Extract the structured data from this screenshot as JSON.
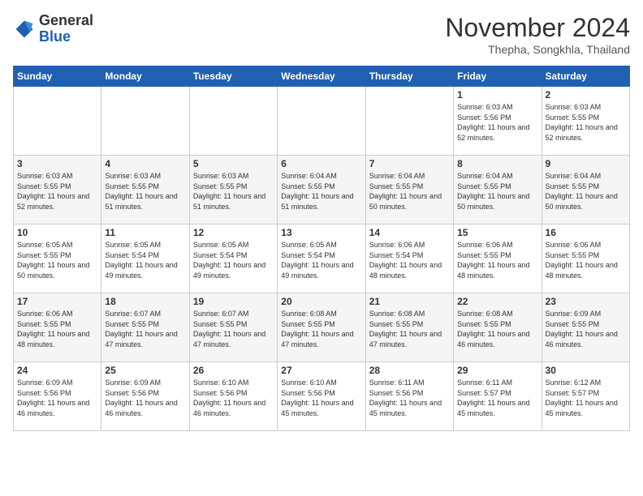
{
  "header": {
    "logo_general": "General",
    "logo_blue": "Blue",
    "month_title": "November 2024",
    "subtitle": "Thepha, Songkhla, Thailand"
  },
  "weekdays": [
    "Sunday",
    "Monday",
    "Tuesday",
    "Wednesday",
    "Thursday",
    "Friday",
    "Saturday"
  ],
  "weeks": [
    [
      null,
      null,
      null,
      null,
      null,
      {
        "day": 1,
        "sunrise": "6:03 AM",
        "sunset": "5:56 PM",
        "daylight": "11 hours and 52 minutes."
      },
      {
        "day": 2,
        "sunrise": "6:03 AM",
        "sunset": "5:55 PM",
        "daylight": "11 hours and 52 minutes."
      }
    ],
    [
      {
        "day": 3,
        "sunrise": "6:03 AM",
        "sunset": "5:55 PM",
        "daylight": "11 hours and 52 minutes."
      },
      {
        "day": 4,
        "sunrise": "6:03 AM",
        "sunset": "5:55 PM",
        "daylight": "11 hours and 51 minutes."
      },
      {
        "day": 5,
        "sunrise": "6:03 AM",
        "sunset": "5:55 PM",
        "daylight": "11 hours and 51 minutes."
      },
      {
        "day": 6,
        "sunrise": "6:04 AM",
        "sunset": "5:55 PM",
        "daylight": "11 hours and 51 minutes."
      },
      {
        "day": 7,
        "sunrise": "6:04 AM",
        "sunset": "5:55 PM",
        "daylight": "11 hours and 50 minutes."
      },
      {
        "day": 8,
        "sunrise": "6:04 AM",
        "sunset": "5:55 PM",
        "daylight": "11 hours and 50 minutes."
      },
      {
        "day": 9,
        "sunrise": "6:04 AM",
        "sunset": "5:55 PM",
        "daylight": "11 hours and 50 minutes."
      }
    ],
    [
      {
        "day": 10,
        "sunrise": "6:05 AM",
        "sunset": "5:55 PM",
        "daylight": "11 hours and 50 minutes."
      },
      {
        "day": 11,
        "sunrise": "6:05 AM",
        "sunset": "5:54 PM",
        "daylight": "11 hours and 49 minutes."
      },
      {
        "day": 12,
        "sunrise": "6:05 AM",
        "sunset": "5:54 PM",
        "daylight": "11 hours and 49 minutes."
      },
      {
        "day": 13,
        "sunrise": "6:05 AM",
        "sunset": "5:54 PM",
        "daylight": "11 hours and 49 minutes."
      },
      {
        "day": 14,
        "sunrise": "6:06 AM",
        "sunset": "5:54 PM",
        "daylight": "11 hours and 48 minutes."
      },
      {
        "day": 15,
        "sunrise": "6:06 AM",
        "sunset": "5:55 PM",
        "daylight": "11 hours and 48 minutes."
      },
      {
        "day": 16,
        "sunrise": "6:06 AM",
        "sunset": "5:55 PM",
        "daylight": "11 hours and 48 minutes."
      }
    ],
    [
      {
        "day": 17,
        "sunrise": "6:06 AM",
        "sunset": "5:55 PM",
        "daylight": "11 hours and 48 minutes."
      },
      {
        "day": 18,
        "sunrise": "6:07 AM",
        "sunset": "5:55 PM",
        "daylight": "11 hours and 47 minutes."
      },
      {
        "day": 19,
        "sunrise": "6:07 AM",
        "sunset": "5:55 PM",
        "daylight": "11 hours and 47 minutes."
      },
      {
        "day": 20,
        "sunrise": "6:08 AM",
        "sunset": "5:55 PM",
        "daylight": "11 hours and 47 minutes."
      },
      {
        "day": 21,
        "sunrise": "6:08 AM",
        "sunset": "5:55 PM",
        "daylight": "11 hours and 47 minutes."
      },
      {
        "day": 22,
        "sunrise": "6:08 AM",
        "sunset": "5:55 PM",
        "daylight": "11 hours and 46 minutes."
      },
      {
        "day": 23,
        "sunrise": "6:09 AM",
        "sunset": "5:55 PM",
        "daylight": "11 hours and 46 minutes."
      }
    ],
    [
      {
        "day": 24,
        "sunrise": "6:09 AM",
        "sunset": "5:56 PM",
        "daylight": "11 hours and 46 minutes."
      },
      {
        "day": 25,
        "sunrise": "6:09 AM",
        "sunset": "5:56 PM",
        "daylight": "11 hours and 46 minutes."
      },
      {
        "day": 26,
        "sunrise": "6:10 AM",
        "sunset": "5:56 PM",
        "daylight": "11 hours and 46 minutes."
      },
      {
        "day": 27,
        "sunrise": "6:10 AM",
        "sunset": "5:56 PM",
        "daylight": "11 hours and 45 minutes."
      },
      {
        "day": 28,
        "sunrise": "6:11 AM",
        "sunset": "5:56 PM",
        "daylight": "11 hours and 45 minutes."
      },
      {
        "day": 29,
        "sunrise": "6:11 AM",
        "sunset": "5:57 PM",
        "daylight": "11 hours and 45 minutes."
      },
      {
        "day": 30,
        "sunrise": "6:12 AM",
        "sunset": "5:57 PM",
        "daylight": "11 hours and 45 minutes."
      }
    ]
  ]
}
